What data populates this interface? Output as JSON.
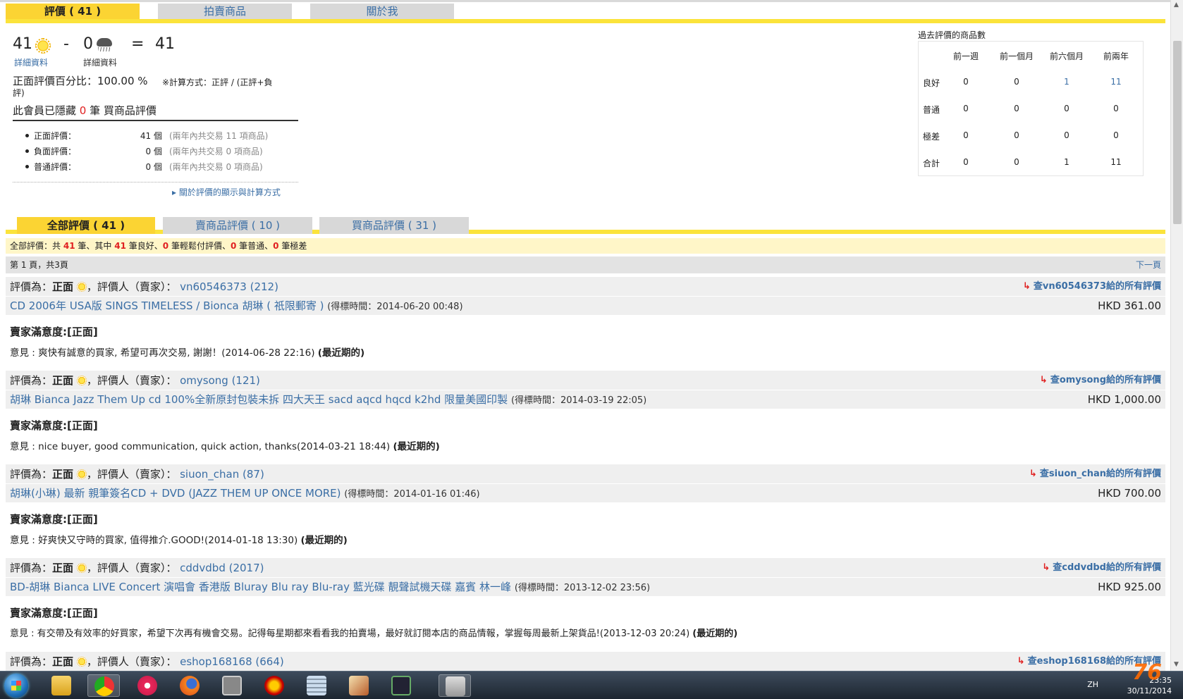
{
  "tabs_top": [
    {
      "label": "評價 ( 41 )",
      "active": true
    },
    {
      "label": "拍賣商品",
      "active": false
    },
    {
      "label": "關於我",
      "active": false
    }
  ],
  "summary": {
    "positive_count": "41",
    "minus": "-",
    "negative_count": "0",
    "equals": "=",
    "total": "41",
    "detail_link_1": "詳細資料",
    "detail_link_2": "詳細資料",
    "positive_pct_label": "正面評價百分比：100.00 %",
    "calc_note_line1": "※計算方式：正評 / (正評+負",
    "calc_note_line2": "評)",
    "hidden_prefix": "此會員已隱藏",
    "hidden_count": "0",
    "hidden_suffix": "筆 買商品評價",
    "rows": [
      {
        "label": "正面評價：",
        "count": "41 個",
        "note": "(兩年內共交易 11 項商品)"
      },
      {
        "label": "負面評價：",
        "count": "0 個",
        "note": "(兩年內共交易 0 項商品)"
      },
      {
        "label": "普通評價：",
        "count": "0 個",
        "note": "(兩年內共交易 0 項商品)"
      }
    ],
    "about_link": "關於評價的顯示與計算方式"
  },
  "past_table": {
    "title": "過去評價的商品數",
    "columns": [
      "前一週",
      "前一個月",
      "前六個月",
      "前兩年"
    ],
    "rows": [
      {
        "label": "良好",
        "values": [
          "0",
          "0",
          "1",
          "11"
        ]
      },
      {
        "label": "普通",
        "values": [
          "0",
          "0",
          "0",
          "0"
        ]
      },
      {
        "label": "極差",
        "values": [
          "0",
          "0",
          "0",
          "0"
        ]
      },
      {
        "label": "合計",
        "values": [
          "0",
          "0",
          "1",
          "11"
        ]
      }
    ]
  },
  "tabs_second": [
    {
      "label": "全部評價 ( 41 )",
      "active": true
    },
    {
      "label": "賣商品評價 ( 10 )",
      "active": false
    },
    {
      "label": "買商品評價 ( 31 )",
      "active": false
    }
  ],
  "info_bar": {
    "p1": "全部評價：共",
    "n1": "41",
    "p2": "筆、其中",
    "n2": "41",
    "p3": "筆良好、",
    "n3": "0",
    "p4": "筆輕鬆付評價、",
    "n4": "0",
    "p5": "筆普通、",
    "n5": "0",
    "p6": "筆極差"
  },
  "pager": {
    "text": "第 1 頁，共3頁",
    "next": "下一頁"
  },
  "entries": [
    {
      "rating_prefix": "評價為：",
      "rating": "正面",
      "rater_label": "，評價人（賣家）：",
      "rater": "vn60546373 (212)",
      "see_all": "查vn60546373給的所有評價",
      "item": "CD 2006年 USA版 SINGS TIMELESS / Bionca 胡琳 ( 祇限郵寄 )",
      "time": "(得標時間：2014-06-20 00:48)",
      "price": "HKD 361.00",
      "satisfaction": "賣家滿意度:[正面]",
      "comment": "意見 : 爽快有誠意的買家, 希望可再次交易, 謝謝！(2014-06-28 22:16)",
      "recent": "(最近期的)"
    },
    {
      "rating_prefix": "評價為：",
      "rating": "正面",
      "rater_label": "，評價人（賣家）：",
      "rater": "omysong (121)",
      "see_all": "查omysong給的所有評價",
      "item": "胡琳 Bianca Jazz Them Up cd 100%全新原封包裝未拆 四大天王 sacd aqcd hqcd k2hd 限量美國印製",
      "time": "(得標時間：2014-03-19 22:05)",
      "price": "HKD 1,000.00",
      "satisfaction": "賣家滿意度:[正面]",
      "comment": "意見 : nice buyer, good communication, quick action, thanks(2014-03-21 18:44)",
      "recent": "(最近期的)"
    },
    {
      "rating_prefix": "評價為：",
      "rating": "正面",
      "rater_label": "，評價人（賣家）：",
      "rater": "siuon_chan (87)",
      "see_all": "查siuon_chan給的所有評價",
      "item": "胡琳(小琳) 最新 親筆簽名CD + DVD (JAZZ THEM UP ONCE MORE)",
      "time": "(得標時間：2014-01-16 01:46)",
      "price": "HKD 700.00",
      "satisfaction": "賣家滿意度:[正面]",
      "comment": "意見 : 好爽快又守時的買家, 值得推介.GOOD!(2014-01-18 13:30)",
      "recent": "(最近期的)"
    },
    {
      "rating_prefix": "評價為：",
      "rating": "正面",
      "rater_label": "，評價人（賣家）：",
      "rater": "cddvdbd (2017)",
      "see_all": "查cddvdbd給的所有評價",
      "item": "BD-胡琳 Bianca LIVE Concert 演唱會 香港版 Bluray Blu ray Blu-ray 藍光碟 靚聲試機天碟 嘉賓 林一峰",
      "time": "(得標時間：2013-12-02 23:56)",
      "price": "HKD 925.00",
      "satisfaction": "賣家滿意度:[正面]",
      "comment": "意見 : 有交帶及有效率的好買家，希望下次再有機會交易。記得每星期都來看看我的拍賣場，最好就訂閱本店的商品情報，掌握每周最新上架貨品!(2013-12-03 20:24)",
      "recent": "(最近期的)"
    },
    {
      "rating_prefix": "評價為：",
      "rating": "正面",
      "rater_label": "，評價人（賣家）：",
      "rater": "eshop168168 (664)",
      "see_all": "查eshop168168給的所有評價"
    }
  ],
  "taskbar": {
    "lang": "ZH",
    "time": "23:35",
    "date": "30/11/2014"
  },
  "watermark": "76"
}
